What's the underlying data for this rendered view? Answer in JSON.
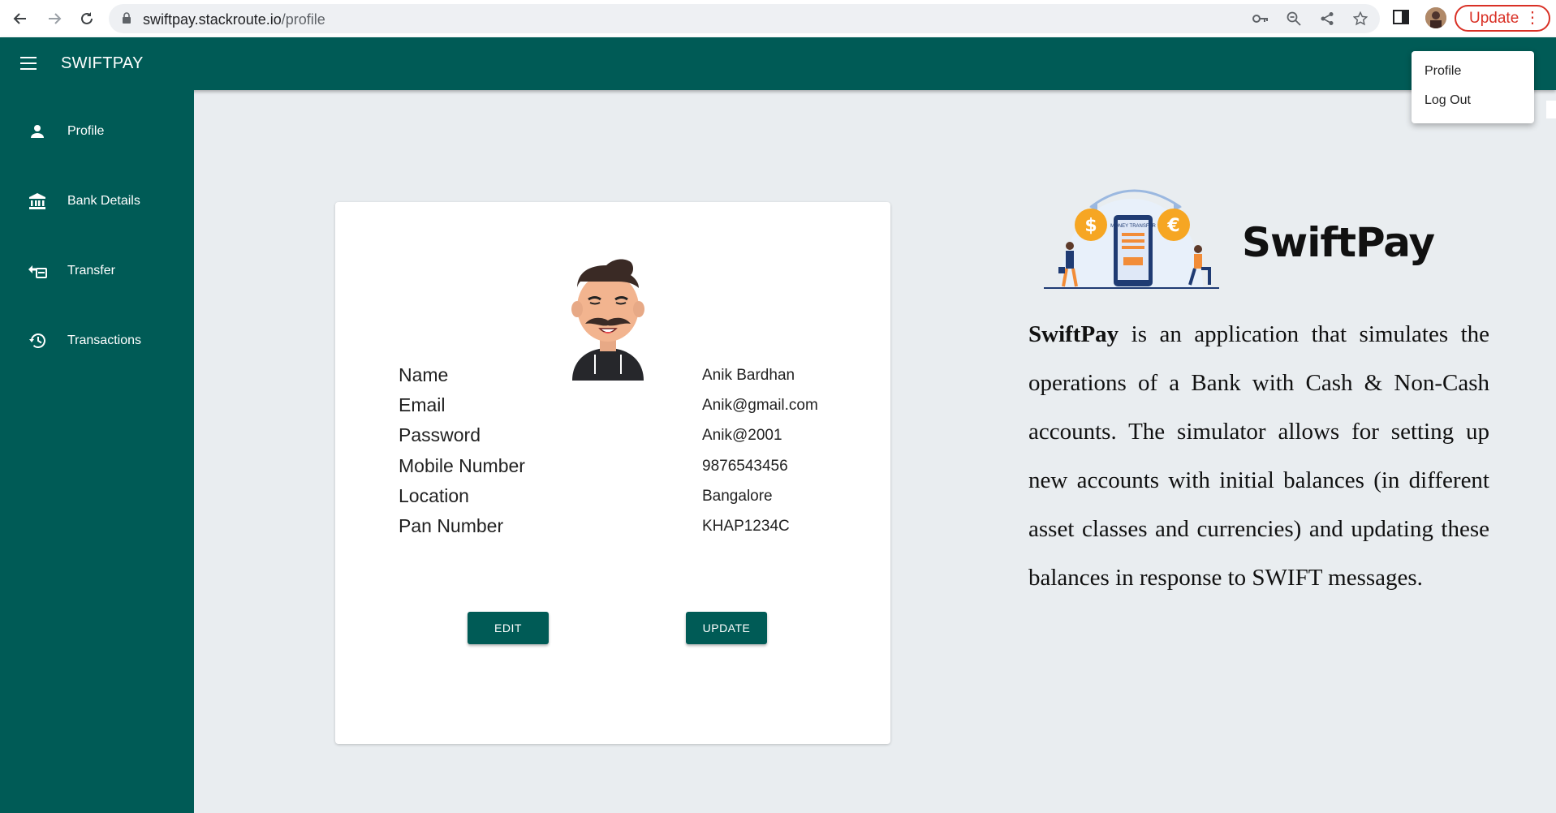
{
  "browser": {
    "url_host": "swiftpay.stackroute.io",
    "url_path": "/profile",
    "update_label": "Update"
  },
  "appbar": {
    "brand": "SWIFTPAY"
  },
  "sidebar": {
    "items": [
      {
        "label": "Profile",
        "icon": "person-icon"
      },
      {
        "label": "Bank Details",
        "icon": "bank-icon"
      },
      {
        "label": "Transfer",
        "icon": "transfer-icon"
      },
      {
        "label": "Transactions",
        "icon": "history-icon"
      }
    ]
  },
  "profile": {
    "fields": [
      {
        "label": "Name",
        "value": "Anik Bardhan"
      },
      {
        "label": "Email",
        "value": "Anik@gmail.com"
      },
      {
        "label": "Password",
        "value": "Anik@2001"
      },
      {
        "label": "Mobile Number",
        "value": "9876543456"
      },
      {
        "label": "Location",
        "value": "Bangalore"
      },
      {
        "label": "Pan Number",
        "value": "KHAP1234C"
      }
    ],
    "edit_label": "EDIT",
    "update_label": "UPDATE"
  },
  "info": {
    "title": "SwiftPay",
    "illustration_label": "MONEY TRANSFER",
    "desc_bold": "SwiftPay",
    "desc_rest": " is an application that simulates the operations of a Bank with Cash & Non-Cash accounts. The simulator allows for setting up new accounts with initial balances (in different asset classes and currencies) and updating these balances in response to SWIFT messages."
  },
  "dropdown": {
    "items": [
      "Profile",
      "Log Out"
    ]
  },
  "colors": {
    "primary": "#005b56",
    "background": "#e9edf0"
  }
}
